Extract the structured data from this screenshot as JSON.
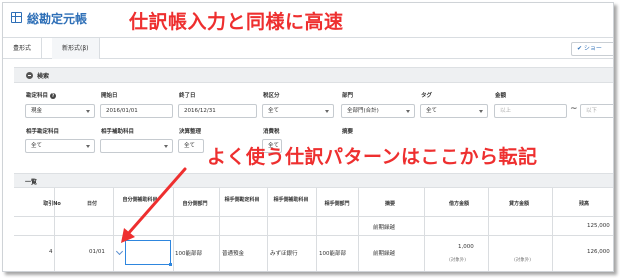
{
  "app": {
    "title": "総勘定元帳"
  },
  "annotations": {
    "headline_top": "仕訳帳入力と同様に高速",
    "headline_mid": "よく使う仕訳パターンはここから転記",
    "accent_color": "#ee2f2f"
  },
  "tabs": [
    {
      "label": "豊形式"
    },
    {
      "label": "新形式(β)"
    }
  ],
  "show_button": {
    "label": "✔ ショー"
  },
  "search": {
    "title": "検索",
    "row1": {
      "account_label": "勘定科目",
      "account_value": "現金",
      "start_label": "開始日",
      "start_value": "2016/01/01",
      "end_label": "終了日",
      "end_value": "2016/12/31",
      "tax_label": "税区分",
      "tax_value": "全て",
      "dept_label": "部門",
      "dept_value": "全部門(合計)",
      "tag_label": "タグ",
      "tag_value": "全て",
      "amount_label": "金額",
      "amount_min_placeholder": "以上",
      "amount_tilde": "~",
      "amount_max_placeholder": "以下"
    },
    "row2": {
      "counter_account_label": "相手勘定科目",
      "counter_account_value": "全て",
      "counter_sub_label": "相手補助科目",
      "settlement_label": "決算整理",
      "settlement_value": "全て",
      "consumption_tax_label": "消費税",
      "consumption_tax_value": "全て",
      "memo_label": "摘要"
    }
  },
  "list": {
    "title": "一覧",
    "columns": [
      "取引No",
      "日付",
      "自分側補助科目",
      "自分側部門",
      "相手側勘定科目",
      "相手側補助科目",
      "相手側部門",
      "摘要",
      "借方金額",
      "貸方金額",
      "残高"
    ],
    "carryover_row": {
      "memo": "前期繰越",
      "balance": "125,000"
    },
    "entry_row": {
      "no": "4",
      "date": "01/01",
      "dept": "100能部部",
      "counter_account": "普通預金",
      "counter_sub": "みずほ銀行",
      "counter_dept": "100能部部",
      "memo": "前期繰越",
      "debit": "1,000",
      "debit_sub": "(対象外)",
      "credit_sub": "(対象外)",
      "balance": "126,000"
    }
  }
}
